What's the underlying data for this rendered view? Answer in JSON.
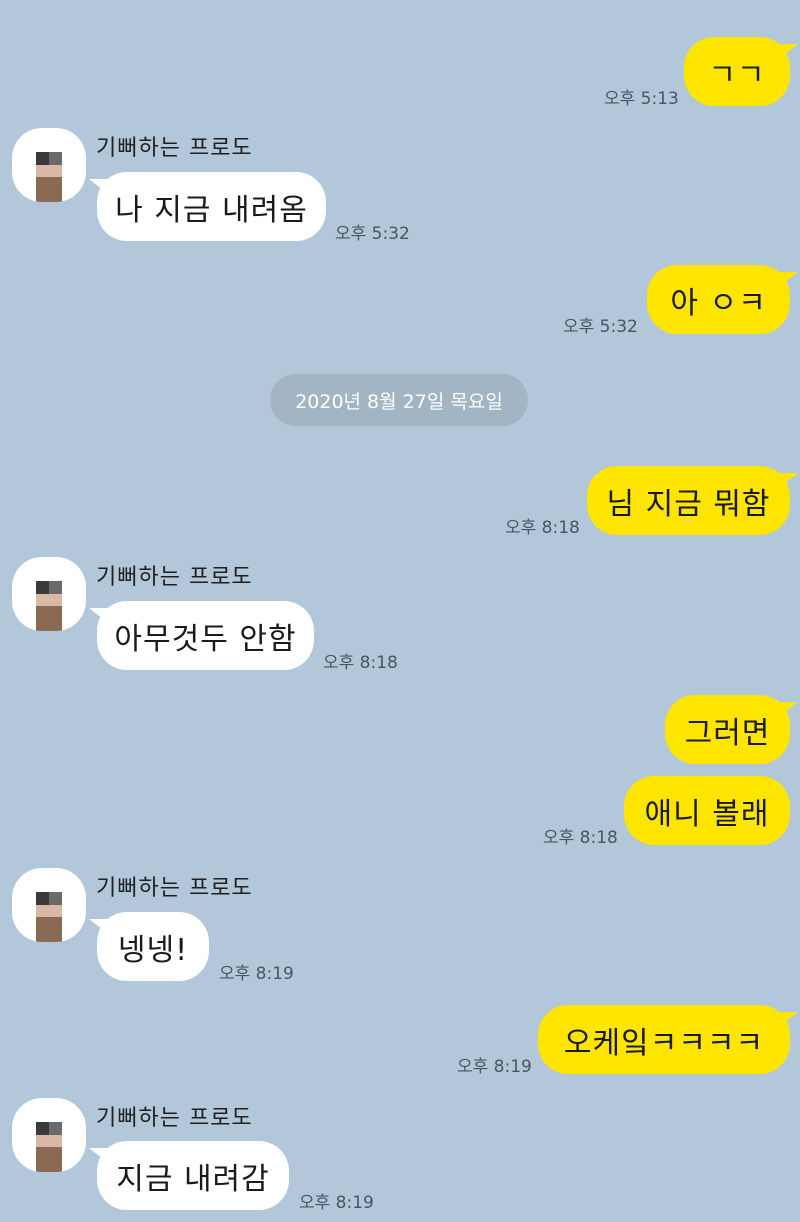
{
  "date_divider": "2020년 8월 27일 목요일",
  "sender_name": "기뻐하는 프로도",
  "messages": [
    {
      "from": "me",
      "text": "ㄱㄱ",
      "time": "오후 5:13"
    },
    {
      "from": "other",
      "text": "나 지금 내려옴",
      "time": "오후 5:32"
    },
    {
      "from": "me",
      "text": "아 ㅇㅋ",
      "time": "오후 5:32"
    },
    {
      "from": "me",
      "text": "님 지금 뭐함",
      "time": "오후 8:18"
    },
    {
      "from": "other",
      "text": "아무것두 안함",
      "time": "오후 8:18"
    },
    {
      "from": "me",
      "text": "그러면",
      "time": ""
    },
    {
      "from": "me",
      "text": "애니 볼래",
      "time": "오후 8:18"
    },
    {
      "from": "other",
      "text": "넹넹!",
      "time": "오후 8:19"
    },
    {
      "from": "me",
      "text": "오케잌ㅋㅋㅋㅋ",
      "time": "오후 8:19"
    },
    {
      "from": "other",
      "text": "지금 내려감",
      "time": "오후 8:19"
    }
  ],
  "colors": {
    "background": "#b2c7da",
    "my_bubble": "#fee500",
    "other_bubble": "#ffffff",
    "date_pill": "#a3b4c4"
  },
  "icons": {
    "avatar": "profile-avatar-pixelated"
  }
}
